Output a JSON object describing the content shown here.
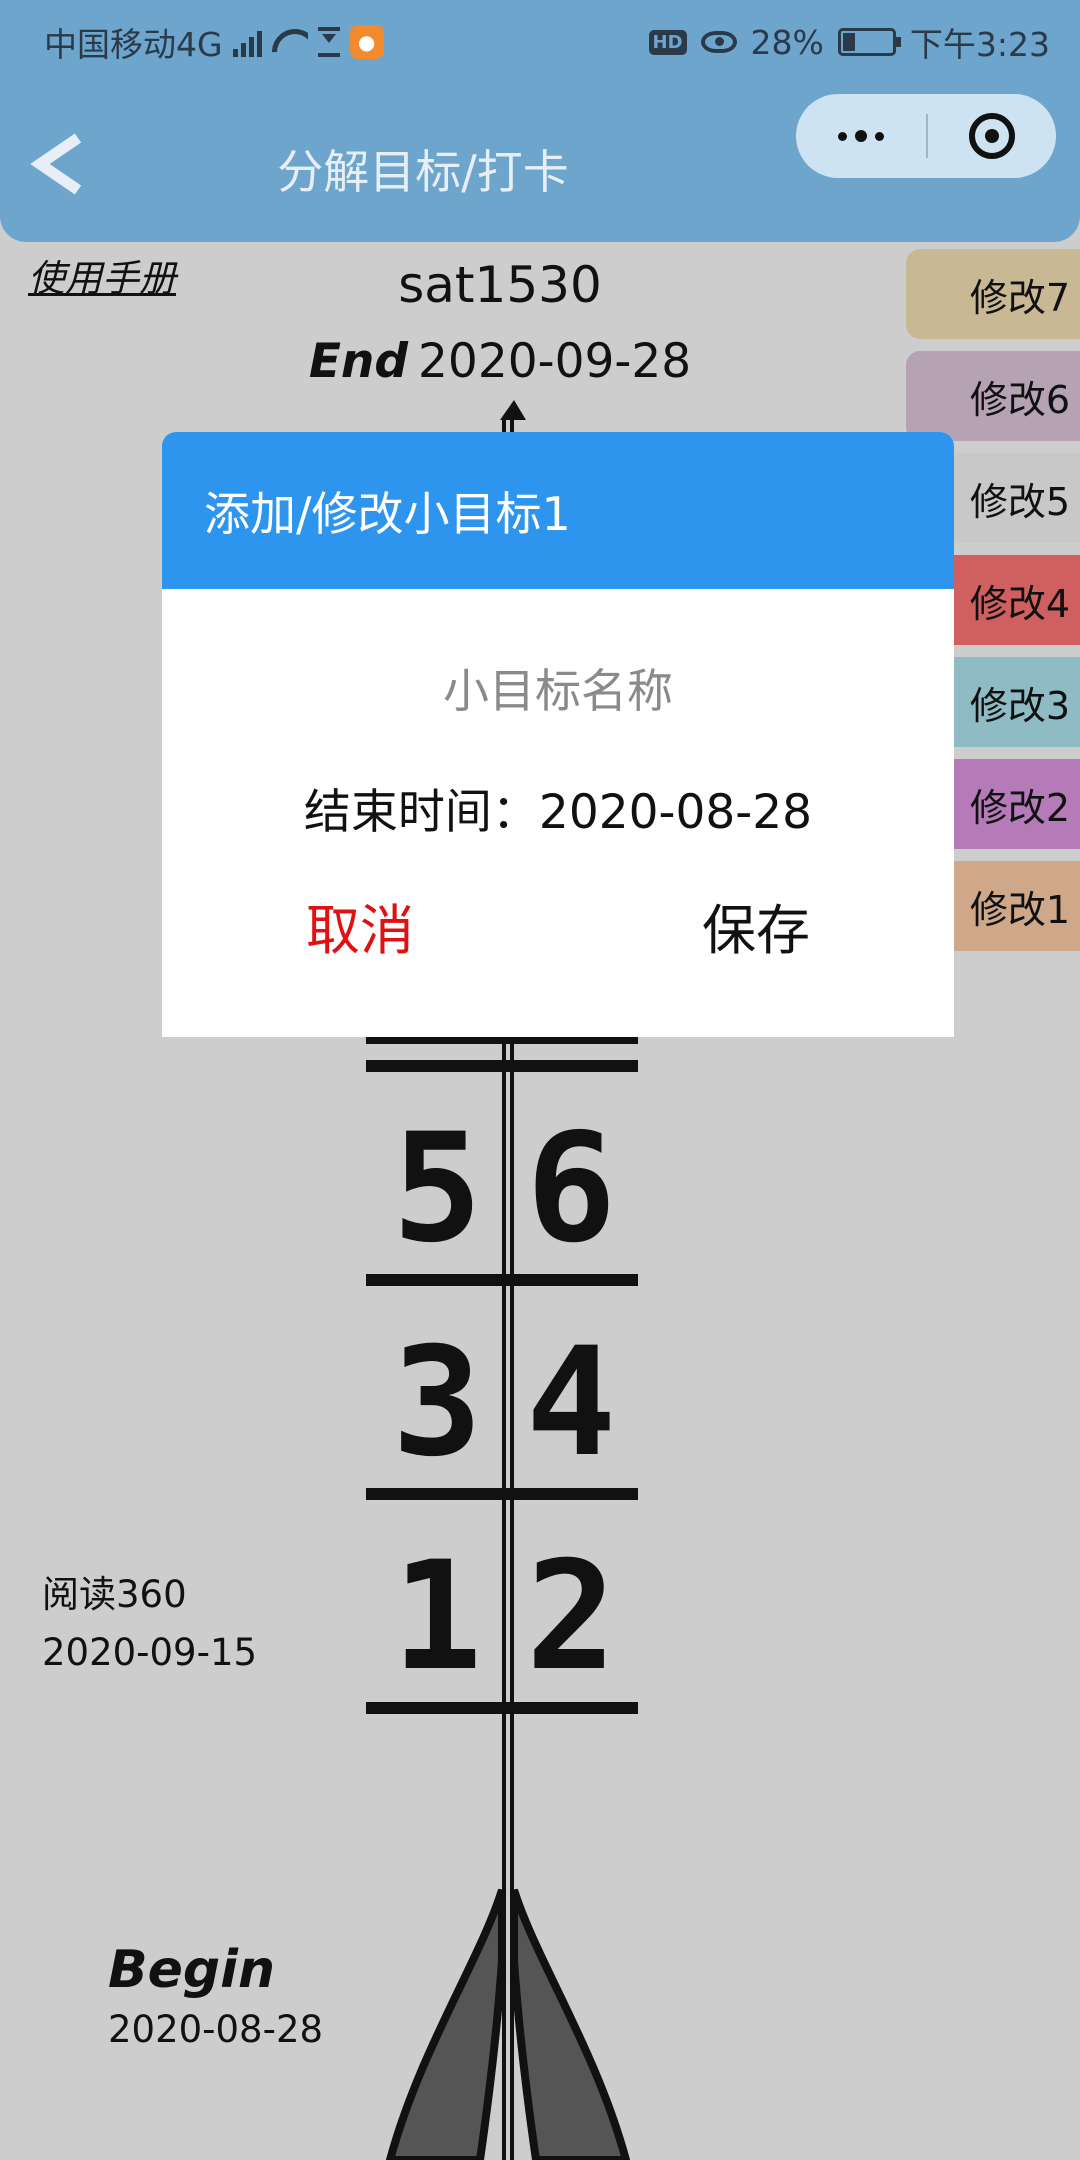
{
  "status_bar": {
    "carrier": "中国移动4G",
    "network_badge": "4G",
    "icons": [
      "signal-icon",
      "wifi-icon",
      "hourglass-icon",
      "uc-browser-icon",
      "hd-icon",
      "eye-icon",
      "battery-icon"
    ],
    "hd_label": "HD",
    "battery": "28%",
    "time": "下午3:23"
  },
  "nav": {
    "title": "分解目标/打卡",
    "back_icon": "chevron-left-icon",
    "more_icon": "more-dots-icon",
    "close_icon": "target-close-icon"
  },
  "page": {
    "manual_link": "使用手册",
    "goal_name": "sat1530",
    "end_label": "End",
    "end_date": "2020-09-28"
  },
  "edit_buttons": [
    {
      "label": "修改7",
      "color": "#c9b894"
    },
    {
      "label": "修改6",
      "color": "#b5a3b5"
    },
    {
      "label": "修改5",
      "color": "#c8c8c8"
    },
    {
      "label": "修改4",
      "color": "#d06060"
    },
    {
      "label": "修改3",
      "color": "#8fbcc4"
    },
    {
      "label": "修改2",
      "color": "#b57ab8"
    },
    {
      "label": "修改1",
      "color": "#cfa88a"
    }
  ],
  "side_goal": {
    "name": "阅读360",
    "date": "2020-09-15"
  },
  "begin": {
    "label": "Begin",
    "date": "2020-08-28"
  },
  "arrow": {
    "visible_numbers": [
      "5",
      "6",
      "3",
      "4",
      "1",
      "2"
    ]
  },
  "modal": {
    "title": "添加/修改小目标1",
    "name_placeholder": "小目标名称",
    "end_time_label": "结束时间：",
    "end_time_value": "2020-08-28",
    "cancel_label": "取消",
    "save_label": "保存"
  },
  "colors": {
    "nav_bar": "#6da5cd",
    "modal_header": "#2e95ef",
    "cancel": "#e01111",
    "background": "#cdcdcd"
  }
}
